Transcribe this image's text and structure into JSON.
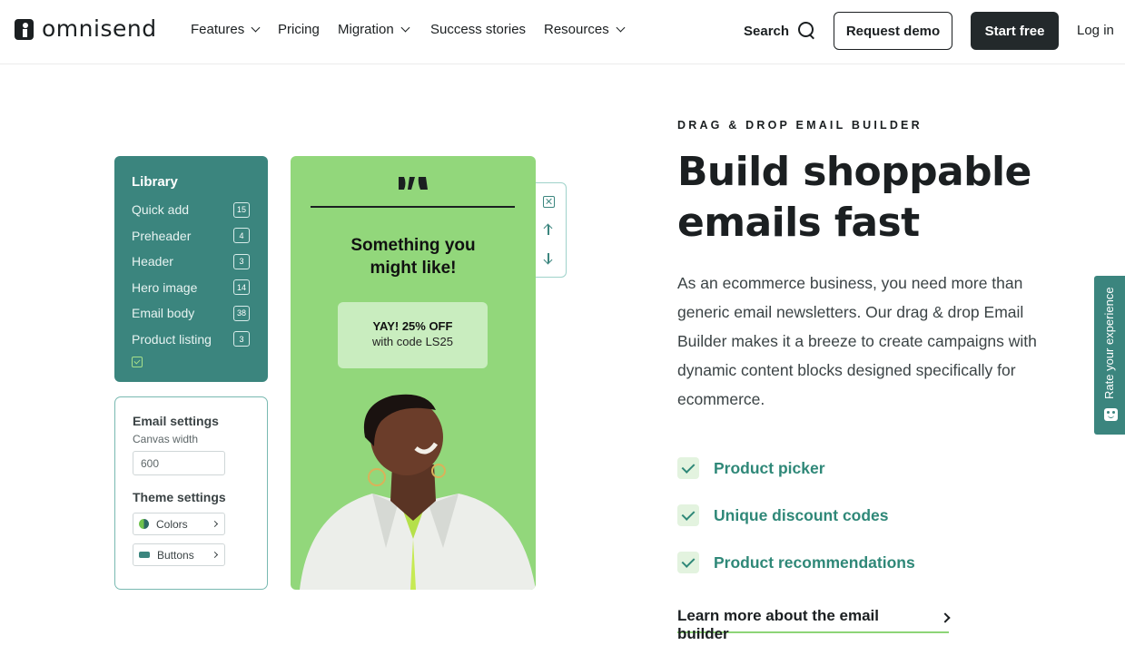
{
  "brand": {
    "name": "omnisend"
  },
  "nav": {
    "items": [
      {
        "label": "Features",
        "dropdown": true
      },
      {
        "label": "Pricing",
        "dropdown": false
      },
      {
        "label": "Migration",
        "dropdown": true
      },
      {
        "label": "Success stories",
        "dropdown": false
      },
      {
        "label": "Resources",
        "dropdown": true
      }
    ],
    "search_label": "Search",
    "request_demo_label": "Request demo",
    "start_free_label": "Start free",
    "login_label": "Log in"
  },
  "library": {
    "title": "Library",
    "items": [
      {
        "label": "Quick add",
        "count": "15"
      },
      {
        "label": "Preheader",
        "count": "4"
      },
      {
        "label": "Header",
        "count": "3"
      },
      {
        "label": "Hero image",
        "count": "14"
      },
      {
        "label": "Email body",
        "count": "38"
      },
      {
        "label": "Product listing",
        "count": "3"
      }
    ]
  },
  "settings": {
    "email_title": "Email settings",
    "canvas_label": "Canvas width",
    "canvas_value": "600",
    "theme_title": "Theme settings",
    "colors_label": "Colors",
    "buttons_label": "Buttons"
  },
  "email_preview": {
    "headline_line1": "Something you",
    "headline_line2": "might like!",
    "promo_line1": "YAY! 25% OFF",
    "promo_line2": "with code LS25"
  },
  "hero": {
    "eyebrow": "DRAG & DROP EMAIL BUILDER",
    "headline_line1": "Build shoppable",
    "headline_line2": "emails fast",
    "description": "As an ecommerce business, you need more than generic email newsletters. Our drag & drop Email Builder makes it a breeze to create campaigns with dynamic content blocks designed specifically for ecommerce.",
    "features": [
      "Product picker",
      "Unique discount codes",
      "Product recommendations"
    ],
    "learn_more": "Learn more about the email builder"
  },
  "feedback": {
    "label": "Rate your experience"
  },
  "colors": {
    "teal": "#3b857e",
    "feature_green": "#2f8878",
    "email_bg": "#92d77b",
    "underline_green": "#8dd577",
    "dark_button": "#23292b"
  }
}
